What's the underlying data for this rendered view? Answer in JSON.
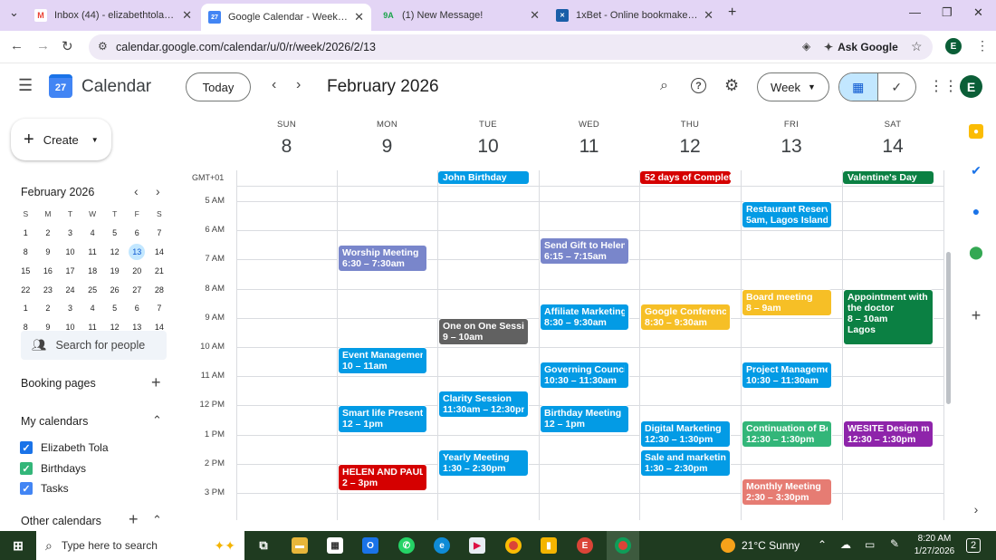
{
  "browser": {
    "tabs": [
      {
        "favicon": "gmail-icon",
        "title": "Inbox (44) - elizabethtola86@g",
        "active": false
      },
      {
        "favicon": "calendar-icon",
        "title": "Google Calendar - Week of Feb",
        "active": true
      },
      {
        "favicon": "9ja-icon",
        "title": "(1) New Message!",
        "active": false
      },
      {
        "favicon": "1xbet-icon",
        "title": "1xBet - Online bookmaker in N",
        "active": false
      }
    ],
    "new_tab": "+",
    "url": "calendar.google.com/calendar/u/0/r/week/2026/2/13",
    "ask_google": "Ask Google",
    "profile_initial": "E"
  },
  "header": {
    "app_name": "Calendar",
    "logo_day": "27",
    "today_label": "Today",
    "month_title": "February 2026",
    "view_label": "Week",
    "profile_initial": "E"
  },
  "sidebar": {
    "create_label": "Create",
    "mini_month": "February 2026",
    "weekday_initials": [
      "S",
      "M",
      "T",
      "W",
      "T",
      "F",
      "S"
    ],
    "weeks": [
      [
        "1",
        "2",
        "3",
        "4",
        "5",
        "6",
        "7"
      ],
      [
        "8",
        "9",
        "10",
        "11",
        "12",
        "13",
        "14"
      ],
      [
        "15",
        "16",
        "17",
        "18",
        "19",
        "20",
        "21"
      ],
      [
        "22",
        "23",
        "24",
        "25",
        "26",
        "27",
        "28"
      ],
      [
        "1",
        "2",
        "3",
        "4",
        "5",
        "6",
        "7"
      ],
      [
        "8",
        "9",
        "10",
        "11",
        "12",
        "13",
        "14"
      ]
    ],
    "selected_day": "13",
    "search_people": "Search for people",
    "booking_pages": "Booking pages",
    "my_calendars": "My calendars",
    "calendars": [
      {
        "name": "Elizabeth Tola",
        "color": "#1a73e8"
      },
      {
        "name": "Birthdays",
        "color": "#33b679"
      },
      {
        "name": "Tasks",
        "color": "#4285f4"
      }
    ],
    "other_calendars": "Other calendars"
  },
  "week": {
    "timezone": "GMT+01",
    "days": [
      {
        "dow": "SUN",
        "num": "8"
      },
      {
        "dow": "MON",
        "num": "9"
      },
      {
        "dow": "TUE",
        "num": "10"
      },
      {
        "dow": "WED",
        "num": "11"
      },
      {
        "dow": "THU",
        "num": "12"
      },
      {
        "dow": "FRI",
        "num": "13"
      },
      {
        "dow": "SAT",
        "num": "14"
      }
    ],
    "times": [
      "5 AM",
      "6 AM",
      "7 AM",
      "8 AM",
      "9 AM",
      "10 AM",
      "11 AM",
      "12 PM",
      "1 PM",
      "2 PM",
      "3 PM"
    ],
    "all_day": [
      {
        "day": 2,
        "title": "John Birthday",
        "color": "#039be5"
      },
      {
        "day": 4,
        "title": "52 days of Completi",
        "color": "#d50000"
      },
      {
        "day": 6,
        "title": "Valentine's Day",
        "color": "#0b8043"
      }
    ],
    "events": [
      {
        "day": 1,
        "title": "Worship Meeting",
        "time": "6:30 – 7:30am",
        "color": "#7986cb"
      },
      {
        "day": 1,
        "title": "Event Management",
        "time": "10 – 11am",
        "color": "#039be5"
      },
      {
        "day": 1,
        "title": "Smart life Presentatio",
        "time": "12 – 1pm",
        "color": "#039be5"
      },
      {
        "day": 1,
        "title": "HELEN AND PAUL",
        "time": "2 – 3pm",
        "color": "#d50000"
      },
      {
        "day": 2,
        "title": "One on One Session",
        "time": "9 – 10am",
        "color": "#616161"
      },
      {
        "day": 2,
        "title": "Clarity Session",
        "time": "11:30am – 12:30pm",
        "color": "#039be5"
      },
      {
        "day": 2,
        "title": "Yearly Meeting",
        "time": "1:30 – 2:30pm",
        "color": "#039be5"
      },
      {
        "day": 3,
        "title": "Send Gift to Helen fo",
        "time": "6:15 – 7:15am",
        "color": "#7986cb"
      },
      {
        "day": 3,
        "title": "Affiliate Marketing Se",
        "time": "8:30 – 9:30am",
        "color": "#039be5"
      },
      {
        "day": 3,
        "title": "Governing Council",
        "time": "10:30 – 11:30am",
        "color": "#039be5"
      },
      {
        "day": 3,
        "title": "Birthday Meeting",
        "time": "12 – 1pm",
        "color": "#039be5"
      },
      {
        "day": 4,
        "title": "Google Conference M",
        "time": "8:30 – 9:30am",
        "color": "#f6bf26"
      },
      {
        "day": 4,
        "title": "Digital Marketing",
        "time": "12:30 – 1:30pm",
        "color": "#039be5"
      },
      {
        "day": 4,
        "title": "Sale and marketing",
        "time": "1:30 – 2:30pm",
        "color": "#039be5"
      },
      {
        "day": 5,
        "title": "Restaurant Reservati",
        "time": "5am, Lagos Island",
        "color": "#039be5"
      },
      {
        "day": 5,
        "title": "Board meeting",
        "time": "8 – 9am",
        "color": "#f6bf26"
      },
      {
        "day": 5,
        "title": "Project Management",
        "time": "10:30 – 11:30am",
        "color": "#039be5"
      },
      {
        "day": 5,
        "title": "Continuation of Boar",
        "time": "12:30 – 1:30pm",
        "color": "#33b679"
      },
      {
        "day": 5,
        "title": "Monthly Meeting",
        "time": "2:30 – 3:30pm",
        "color": "#e67c73"
      },
      {
        "day": 6,
        "title": "Appointment with the doctor",
        "time": "8 – 10am",
        "location": "Lagos",
        "color": "#0b8043"
      },
      {
        "day": 6,
        "title": "WESITE Design meet",
        "time": "12:30 – 1:30pm",
        "color": "#8e24aa"
      }
    ]
  },
  "taskbar": {
    "search_placeholder": "Type here to search",
    "weather": "21°C  Sunny",
    "time": "8:20 AM",
    "date": "1/27/2026",
    "notifications": "2"
  }
}
